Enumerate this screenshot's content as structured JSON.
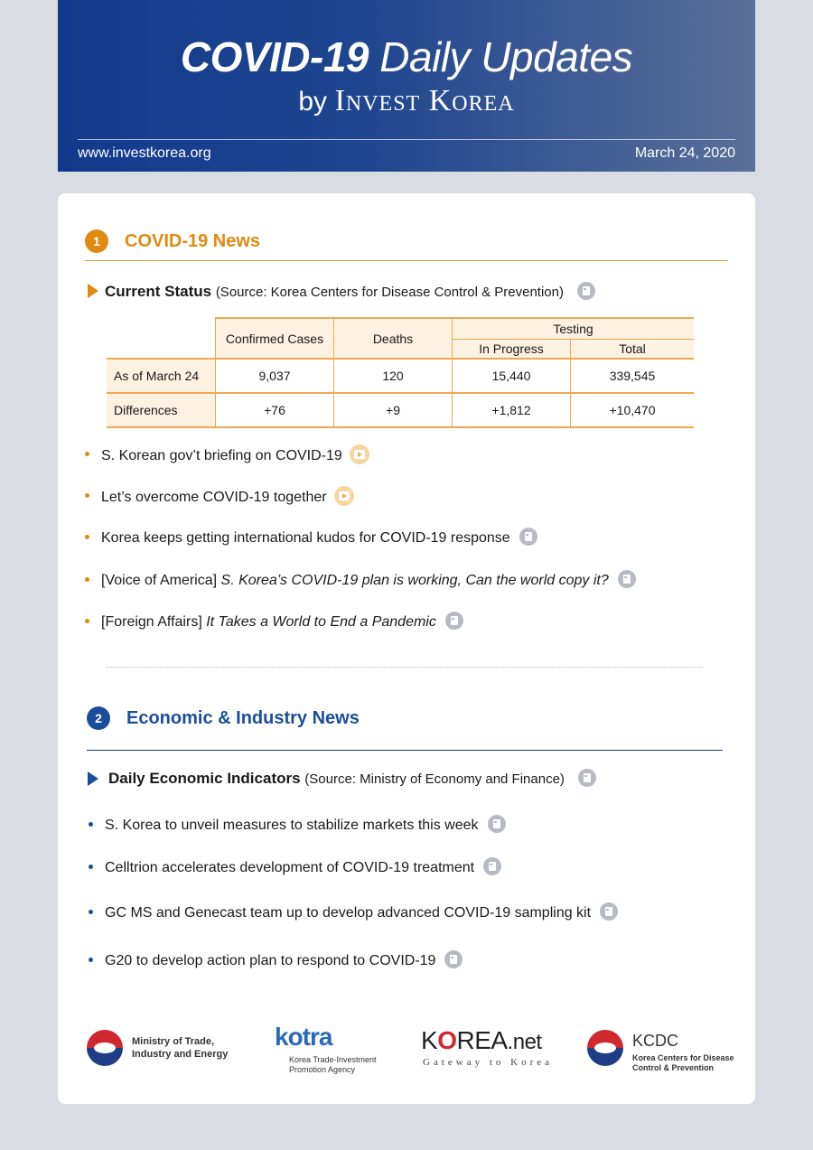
{
  "header": {
    "title_bold": "COVID-19",
    "title_light": "Daily Updates",
    "byline_by": "by",
    "byline_name": "Invest Korea",
    "url": "www.investkorea.org",
    "date": "March 24, 2020"
  },
  "section1": {
    "number": "1",
    "title": "COVID-19  News",
    "subhead_bold": "Current Status",
    "subhead_source": "(Source: Korea Centers for Disease Control & Prevention)",
    "table": {
      "col_confirmed": "Confirmed Cases",
      "col_deaths": "Deaths",
      "col_testing": "Testing",
      "col_in_progress": "In Progress",
      "col_total": "Total",
      "rows": [
        {
          "label": "As of March 24",
          "confirmed": "9,037",
          "deaths": "120",
          "in_progress": "15,440",
          "total": "339,545"
        },
        {
          "label": "Differences",
          "confirmed": "+76",
          "deaths": "+9",
          "in_progress": "+1,812",
          "total": "+10,470"
        }
      ]
    },
    "bullets": [
      {
        "text": "S. Korean gov’t briefing on COVID-19",
        "italic": ""
      },
      {
        "text": "Let’s overcome COVID-19 together",
        "italic": ""
      },
      {
        "text": "Korea keeps getting international kudos for COVID-19 response",
        "italic": ""
      },
      {
        "text": "[Voice of America] ",
        "italic": "S. Korea’s COVID-19 plan is working, Can the world copy it?"
      },
      {
        "text": "[Foreign Affairs] ",
        "italic": "It Takes a World to End a Pandemic"
      }
    ]
  },
  "section2": {
    "number": "2",
    "title": "Economic  &  Industry  News",
    "subhead_bold": "Daily Economic Indicators",
    "subhead_source": "(Source: Ministry of Economy and Finance)",
    "bullets": [
      {
        "text": "S. Korea to unveil measures to stabilize markets this week"
      },
      {
        "text": "Celltrion accelerates development of COVID-19 treatment"
      },
      {
        "text": "GC MS and Genecast team up to develop advanced COVID-19 sampling kit"
      },
      {
        "text": "G20 to develop action plan to respond to COVID-19"
      }
    ]
  },
  "footer": {
    "motie_line1": "Ministry of Trade,",
    "motie_line2": "Industry and Energy",
    "kotra": "kotra",
    "kotra_line1": "Korea Trade-Investment",
    "kotra_line2": "Promotion Agency",
    "koreanet_k": "K",
    "koreanet_o": "O",
    "koreanet_rea": "REA",
    "koreanet_net": ".net",
    "koreanet_sub": "Gateway to Korea",
    "kcdc": "KCDC",
    "kcdc_line1": "Korea Centers for Disease",
    "kcdc_line2": "Control & Prevention"
  },
  "colors": {
    "header_blue": "#123a8c",
    "section1_accent": "#e08a12",
    "section2_accent": "#1a4e9b",
    "table_border": "#f0a850",
    "table_fill": "#fdf1e1"
  }
}
